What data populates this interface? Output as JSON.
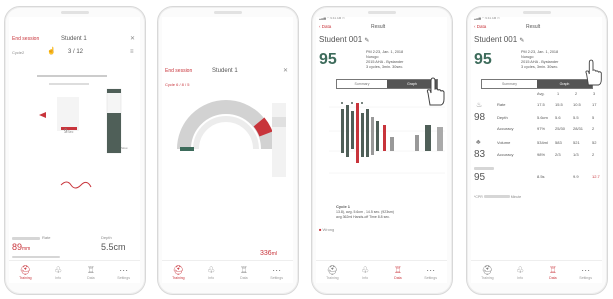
{
  "colors": {
    "accent": "#c8343b",
    "chart_green": "#3d6b5b",
    "chart_dark": "#4f5f58"
  },
  "screen1": {
    "end_session": "End session",
    "student": "Student 1",
    "cycle_label": "Cycle2",
    "cycle_count": "3 / 12",
    "rate": "9",
    "rate_unit": "Sec",
    "slow": "Slow",
    "rate_label": "Rate",
    "depth_label": "Depth",
    "depth_value": "89",
    "depth_unit": "mm",
    "depth_value2": "5.5cm",
    "tabs": [
      "Training",
      "Info",
      "Data",
      "Settings"
    ]
  },
  "screen2": {
    "end_session": "End session",
    "student": "Student 1",
    "cycle_label": "Cycle 6 / 8  / 5",
    "volume": "336",
    "volume_unit": "ml",
    "tabs": [
      "Training",
      "Info",
      "Data",
      "Settings"
    ]
  },
  "screen3": {
    "back": "Data",
    "title": "Result",
    "student": "Student 001",
    "score": "95",
    "info": [
      "PM 2:23, Jan. 1, 2018",
      "Nurugo",
      "2015 AHA - Bystander",
      "3 cycles, 3min. 30sec."
    ],
    "tab_summary": "Summary",
    "tab_graph": "Graph",
    "cycle_title": "Cycle 1",
    "cycle_detail1": "13.8), avg. 5.6cm , 14.5 sec. (923sm)",
    "cycle_detail2": "avg 362ml Hands-off Time 8.8 sec.",
    "legend_wrong": "Wrong",
    "tabs": [
      "Training",
      "Info",
      "Data",
      "Settings"
    ]
  },
  "screen4": {
    "back": "Data",
    "title": "Result",
    "student": "Student 001",
    "score": "95",
    "info": [
      "PM 2:23, Jan. 1, 2018",
      "Nurugo",
      "2015 AHA - Bystander",
      "3 cycles, 3min. 30sec."
    ],
    "tab_summary": "Summary",
    "tab_graph": "Graph",
    "col_headers": [
      "Avg.",
      "1",
      "2",
      "3"
    ],
    "score_compress": "98",
    "score_volume": "83",
    "score_other": "95",
    "rows": [
      {
        "label": "Rate",
        "values": [
          "17.5",
          "15.5",
          "10.5",
          "17"
        ]
      },
      {
        "label": "Depth",
        "values": [
          "5.6cm",
          "5.6",
          "5.5",
          "5"
        ]
      },
      {
        "label": "Accuracy",
        "values": [
          "97%",
          "25/30",
          "28/31",
          "2"
        ]
      },
      {
        "label": "Volume",
        "values": [
          "534ml",
          "583",
          "521",
          "52"
        ]
      },
      {
        "label": "Accuracy",
        "values": [
          "98%",
          "2/3",
          "1/3",
          "2"
        ]
      },
      {
        "label": "",
        "values": [
          "8.5s",
          "",
          "9.9",
          "12.7"
        ]
      }
    ],
    "cpr_note": "*CPR",
    "cpr_note2": "Minute",
    "tabs": [
      "Training",
      "Info",
      "Data",
      "Settings"
    ]
  }
}
